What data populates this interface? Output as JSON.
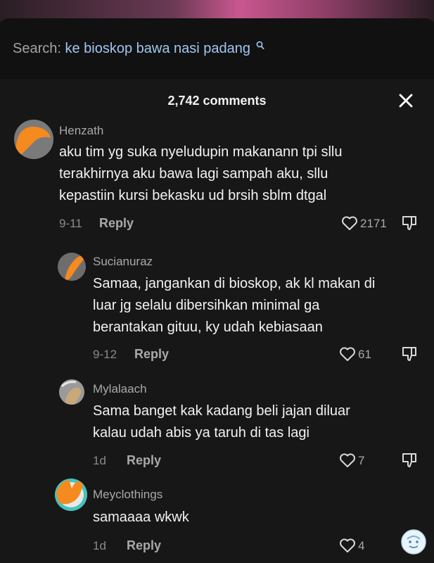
{
  "search": {
    "prefix": "Search: ",
    "query": "ke bioskop bawa nasi padang"
  },
  "header": {
    "comments_count": "2,742 comments"
  },
  "comments": [
    {
      "username": "Henzath",
      "text": "aku tim yg suka nyeludupin makanann tpi sllu\nterakhirnya aku bawa lagi sampah aku, sllu\nkepastiin kursi bekasku ud brsih sblm dtgal",
      "date": "9-11",
      "reply": "Reply",
      "likes": "2171"
    },
    {
      "username": "Sucianuraz",
      "text": "Samaa, jangankan di bioskop, ak kl makan di\nluar jg selalu dibersihkan minimal ga\nberantakan gituu, ky udah kebiasaan",
      "date": "9-12",
      "reply": "Reply",
      "likes": "61"
    },
    {
      "username": "Mylalaach",
      "text": "Sama banget kak kadang beli jajan diluar\nkalau udah abis ya taruh di tas lagi",
      "date": "1d",
      "reply": "Reply",
      "likes": "7"
    },
    {
      "username": "Meyclothings",
      "text": "samaaaa wkwk",
      "date": "1d",
      "reply": "Reply",
      "likes": "4"
    }
  ],
  "colors": {
    "background": "#171717",
    "search_query": "#9fc7f0",
    "redaction": "#f58a1f"
  }
}
